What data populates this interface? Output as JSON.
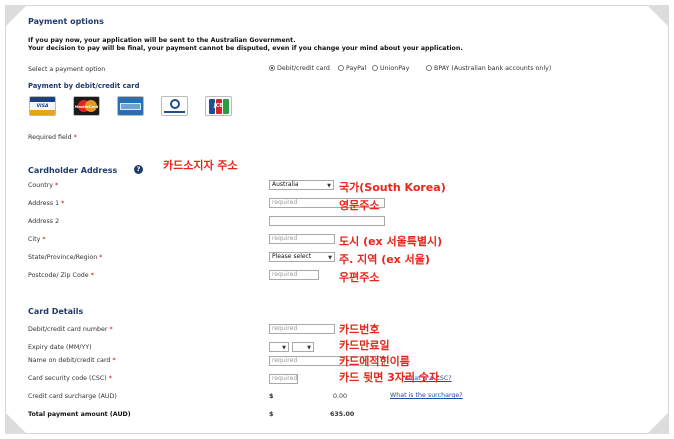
{
  "header": {
    "title": "Payment options",
    "notice_line1": "If you pay now, your application will be sent to the Australian Government.",
    "notice_line2": "Your decision to pay will be final, your payment cannot be disputed, even if you change your mind about your application."
  },
  "payment_option": {
    "label": "Select a payment option",
    "options": [
      {
        "label": "Debit/credit card",
        "selected": true
      },
      {
        "label": "PayPal",
        "selected": false
      },
      {
        "label": "UnionPay",
        "selected": false
      },
      {
        "label": "BPAY (Australian bank accounts only)",
        "selected": false
      }
    ]
  },
  "card_section": {
    "title": "Payment by debit/credit card",
    "cards": [
      {
        "name": "VISA",
        "icon": "visa-card-icon"
      },
      {
        "name": "MasterCard",
        "icon": "mastercard-card-icon"
      },
      {
        "name": "American Express",
        "icon": "amex-card-icon"
      },
      {
        "name": "Diners Club International",
        "icon": "diners-card-icon"
      },
      {
        "name": "JCB",
        "icon": "jcb-card-icon"
      }
    ]
  },
  "required_field_label": "Required field",
  "required_marker": "*",
  "cardholder": {
    "title": "Cardholder Address",
    "help_icon": "?",
    "country": {
      "label": "Country",
      "value": "Australia"
    },
    "address1": {
      "label": "Address 1",
      "placeholder": "required"
    },
    "address2": {
      "label": "Address 2",
      "placeholder": ""
    },
    "city": {
      "label": "City",
      "placeholder": "required"
    },
    "state": {
      "label": "State/Province/Region",
      "value": "Please select"
    },
    "postcode": {
      "label": "Postcode/ Zip Code",
      "placeholder": "required"
    }
  },
  "card_details": {
    "title": "Card Details",
    "number": {
      "label": "Debit/credit card number",
      "placeholder": "required"
    },
    "expiry": {
      "label": "Expiry date (MM/YY)"
    },
    "name": {
      "label": "Name on debit/credit card",
      "placeholder": "required"
    },
    "csc": {
      "label": "Card security code (CSC)",
      "placeholder": "required",
      "link": "What is a CSC?"
    },
    "surcharge": {
      "label": "Credit card surcharge (AUD)",
      "currency": "$",
      "amount": "0.00",
      "link": "What is the surcharge?"
    },
    "total": {
      "label": "Total payment amount (AUD)",
      "currency": "$",
      "amount": "635.00"
    }
  },
  "annotations": {
    "cardholder": "카드소지자 주소",
    "country": "국가(South Korea)",
    "address1": "영문주소",
    "city": "도시 (ex 서울특별시)",
    "state": "주. 지역 (ex 서울)",
    "postcode": "우편주소",
    "number": "카드번호",
    "expiry": "카드만료일",
    "name": "카드에적힌이름",
    "csc": "카드 뒷면 3자리 숫자"
  },
  "colors": {
    "heading": "#1f3a6b",
    "annotation": "#e8251a",
    "required": "#cc0000",
    "link": "#1d4fa0"
  }
}
